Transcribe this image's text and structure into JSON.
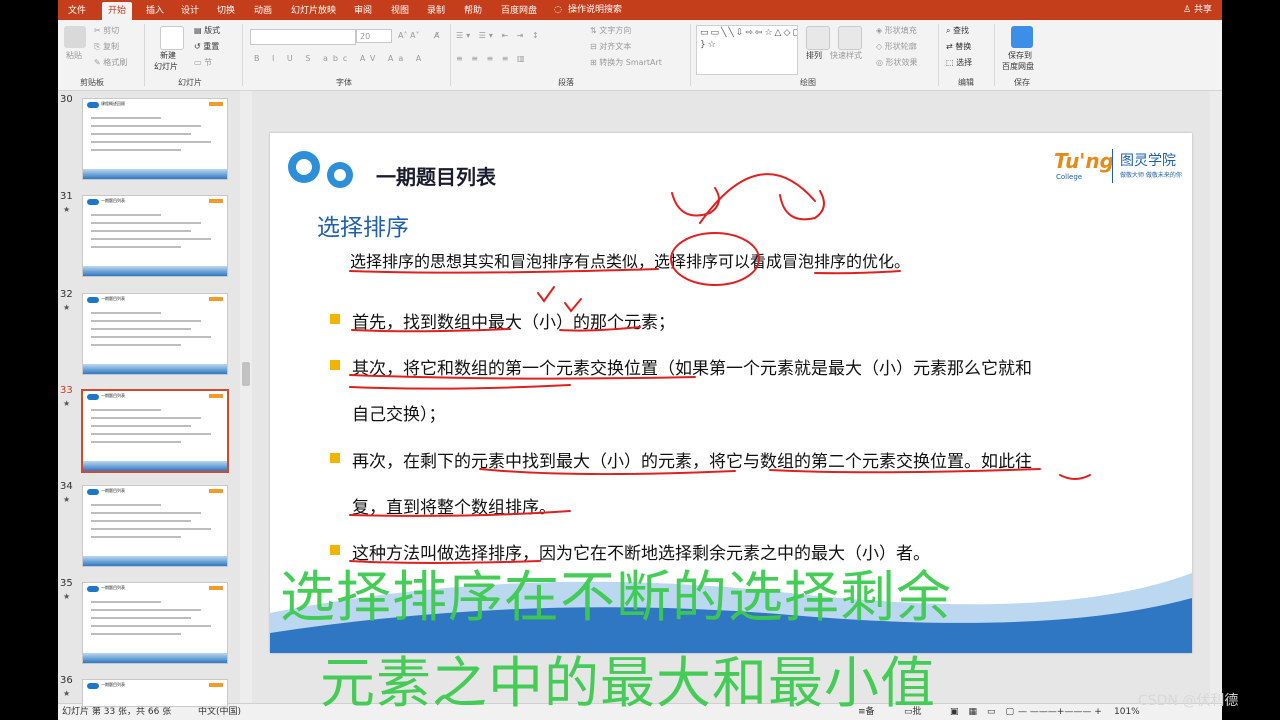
{
  "ribbon_tabs": [
    "文件",
    "开始",
    "插入",
    "设计",
    "切换",
    "动画",
    "幻灯片放映",
    "审阅",
    "视图",
    "录制",
    "帮助",
    "百度网盘"
  ],
  "active_tab": "开始",
  "tell_me": "操作说明搜索",
  "share": "共享",
  "clipboard": {
    "paste": "粘贴",
    "cut": "剪切",
    "copy": "复制",
    "format_painter": "格式刷",
    "label": "剪贴板"
  },
  "slides_group": {
    "new_slide": "新建",
    "new_slide2": "幻灯片",
    "layout": "版式",
    "reset": "重置",
    "section": "节",
    "label": "幻灯片"
  },
  "font_group": {
    "size": "20",
    "label": "字体"
  },
  "paragraph_group": {
    "text_direction": "文字方向",
    "align_text": "对齐文本",
    "smartart": "转换为 SmartArt",
    "label": "段落"
  },
  "drawing_group": {
    "arrange": "排列",
    "quick_styles": "快速样式",
    "shape_fill": "形状填充",
    "shape_outline": "形状轮廓",
    "shape_effects": "形状效果",
    "label": "绘图"
  },
  "editing_group": {
    "find": "查找",
    "replace": "替换",
    "select": "选择",
    "label": "编辑"
  },
  "save_group": {
    "save1": "保存到",
    "save2": "百度网盘",
    "label": "保存"
  },
  "thumbnails": [
    {
      "num": "30",
      "title": "课程概述回顾"
    },
    {
      "num": "31",
      "title": "一期题目列表"
    },
    {
      "num": "32",
      "title": "一期题目列表"
    },
    {
      "num": "33",
      "title": "一期题目列表"
    },
    {
      "num": "34",
      "title": "一期题目列表"
    },
    {
      "num": "35",
      "title": "一期题目列表"
    },
    {
      "num": "36",
      "title": "一期题目列表"
    }
  ],
  "slide": {
    "title": "一期题目列表",
    "subtitle": "选择排序",
    "intro": "选择排序的思想其实和冒泡排序有点类似，选择排序可以看成冒泡排序的优化。",
    "bullets": [
      "首先，找到数组中最大（小）的那个元素；",
      "其次，将它和数组的第一个元素交换位置（如果第一个元素就是最大（小）元素那么它就和",
      "自己交换）；",
      "再次，在剩下的元素中找到最大（小）的元素，将它与数组的第二个元素交换位置。如此往",
      "复，直到将整个数组排序。",
      "这种方法叫做选择排序，因为它在不断地选择剩余元素之中的最大（小）者。"
    ],
    "logo_en": "Tu'ng",
    "logo_college": "College",
    "logo_cn": "图灵学院",
    "logo_slogan": "做敬大师 做敬未来的你"
  },
  "status": {
    "slide_info": "幻灯片 第 33 张，共 66 张",
    "language": "中文(中国)",
    "notes": "备注",
    "comments": "批注",
    "zoom": "101%"
  },
  "caption_line1": "选择排序在不断的选择剩余",
  "caption_line2": "元素之中的最大和最小值",
  "watermark": "CSDN @伏利德",
  "colors": {
    "ribbon": "#c43e1c",
    "accent_blue": "#1f5fad",
    "ink_red": "#e02020",
    "caption_green": "#3ccb4f",
    "bullet_yellow": "#f1b400"
  }
}
